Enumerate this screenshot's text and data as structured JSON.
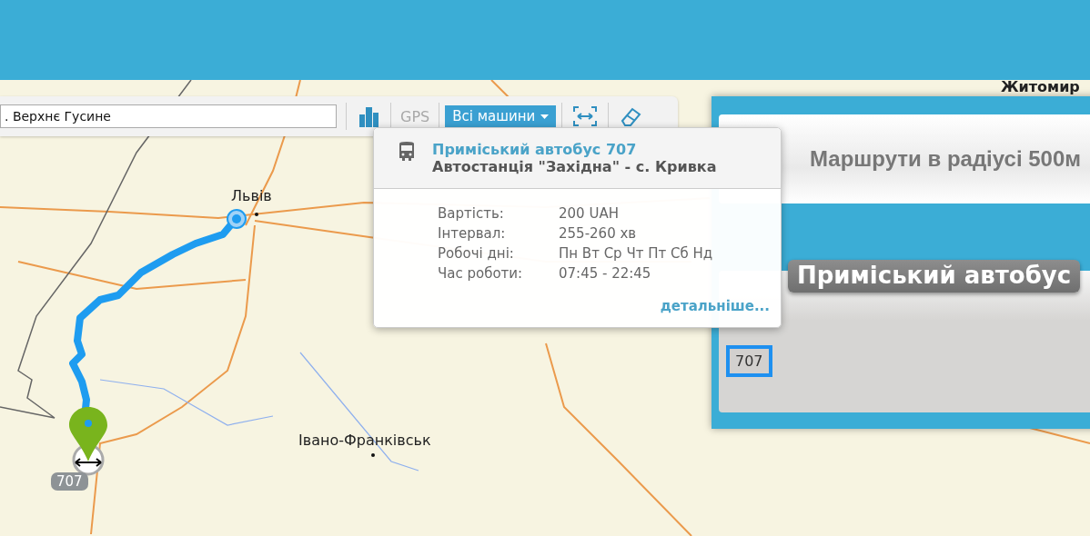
{
  "search": {
    "value": ". Верхнє Гусине"
  },
  "toolbar": {
    "gps": {
      "label": "GPS",
      "disabled": true
    },
    "vehicles": {
      "label": "Всі машини"
    }
  },
  "map_labels": [
    {
      "kind": "city",
      "text": "Львів"
    },
    {
      "kind": "city",
      "text": "Івано-Франківськ"
    },
    {
      "kind": "edge",
      "text": "Житомир"
    }
  ],
  "route_marker": {
    "badge": "707"
  },
  "popup": {
    "title": "Приміський автобус 707",
    "subtitle": "Автостанція \"Західна\" - с. Кривка",
    "rows": [
      {
        "label": "Вартість:",
        "value": "200 UAH"
      },
      {
        "label": "Інтервал:",
        "value": "255-260 хв"
      },
      {
        "label": "Робочі дні:",
        "value": "Пн Вт Ср Чт Пт Сб Нд"
      },
      {
        "label": "Час роботи:",
        "value": "07:45 - 22:45"
      }
    ],
    "link": "детальніше..."
  },
  "panel": {
    "title": "Маршрути в радіусі 500м",
    "group": "Приміський автобус",
    "routes": [
      {
        "label": "707",
        "selected": true
      }
    ]
  }
}
